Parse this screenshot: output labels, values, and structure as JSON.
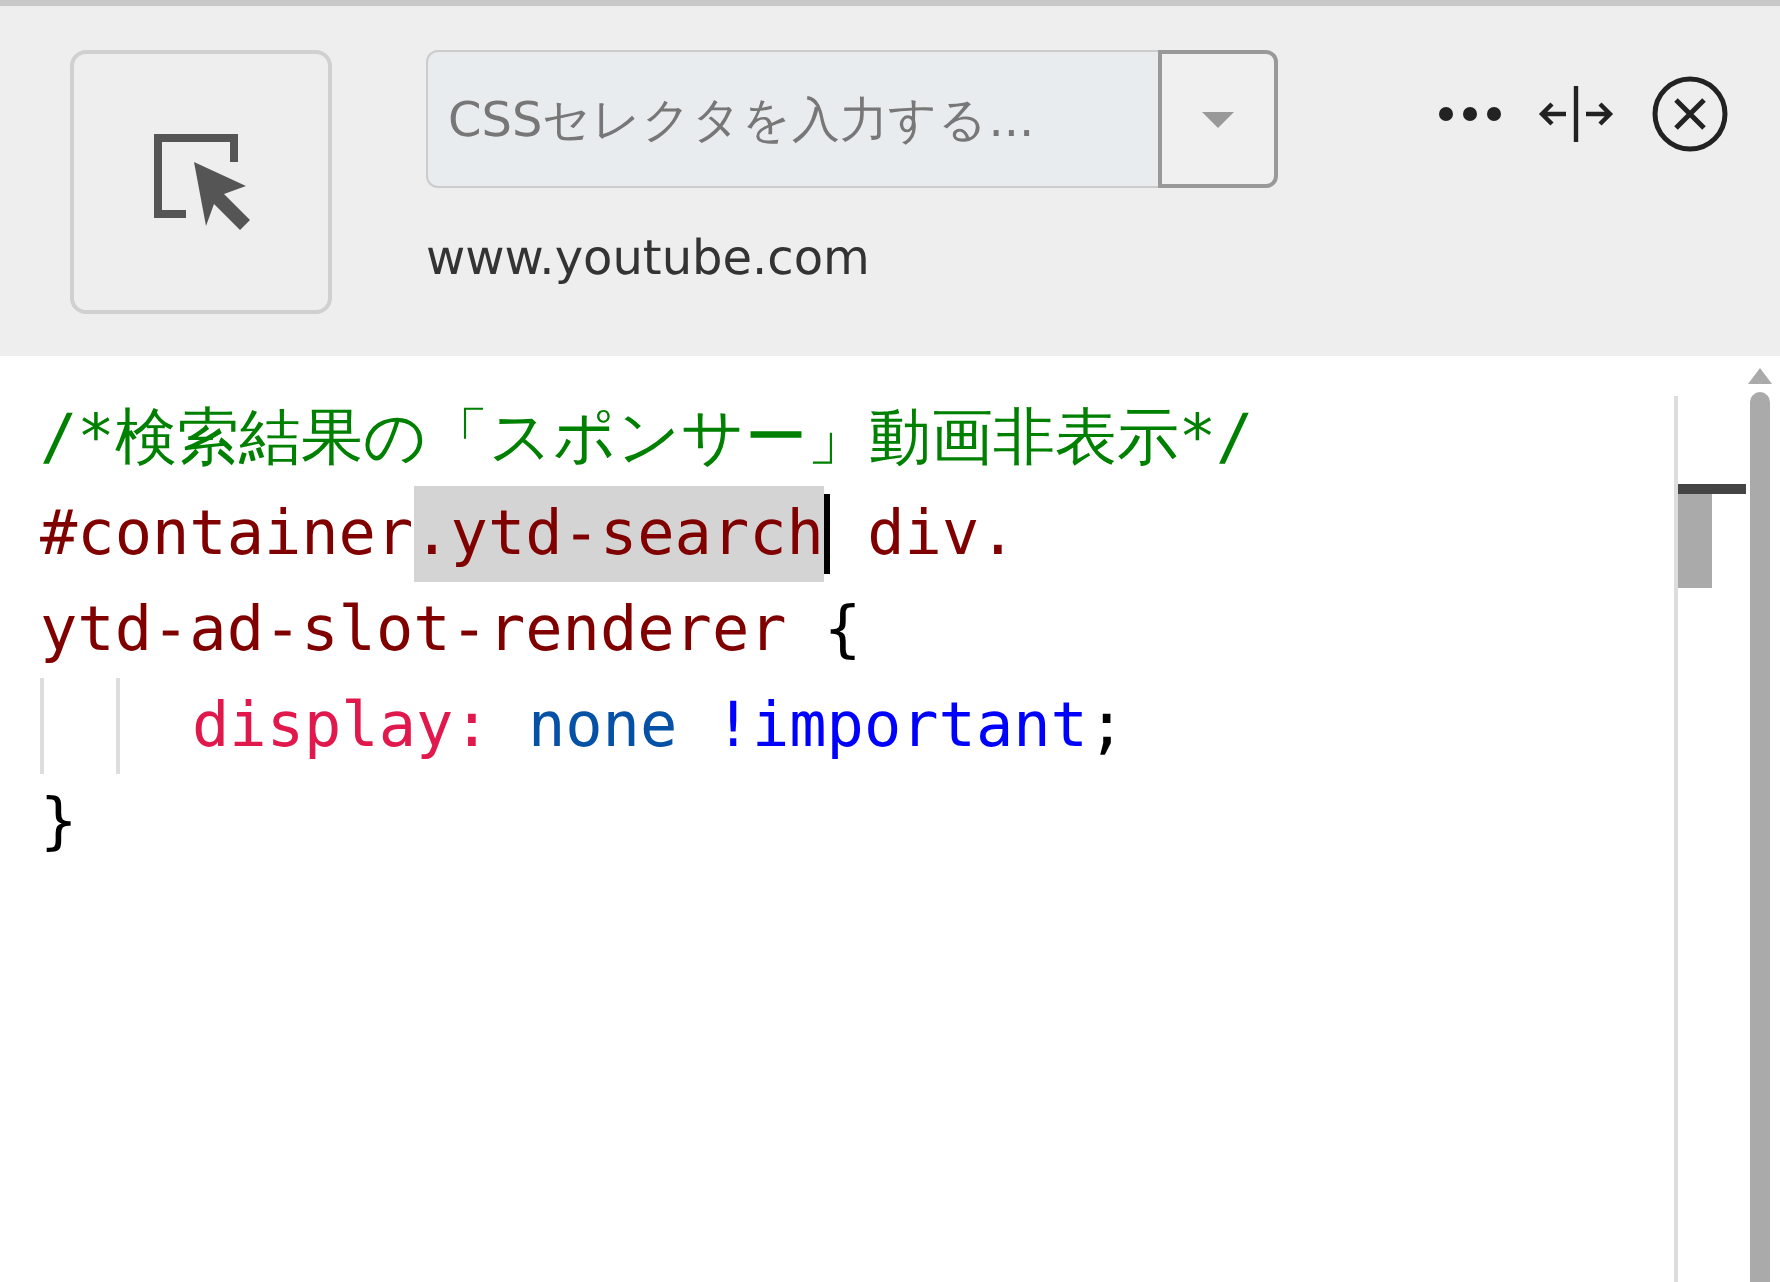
{
  "toolbar": {
    "selector_field": {
      "placeholder": "CSSセレクタを入力する..."
    },
    "hostname": "www.youtube.com"
  },
  "editor": {
    "lines": [
      {
        "indented": false,
        "tokens": [
          {
            "text": "/*検索結果の「スポンサー」動画非表示*/",
            "kind": "comment",
            "selected": false
          }
        ]
      },
      {
        "indented": false,
        "tokens": [
          {
            "text": "#container",
            "kind": "selector",
            "selected": false
          },
          {
            "text": ".ytd-search",
            "kind": "selector",
            "selected": true
          },
          {
            "text": " div.",
            "kind": "selector",
            "selected": false
          }
        ]
      },
      {
        "indented": false,
        "tokens": [
          {
            "text": "ytd-ad-slot-renderer",
            "kind": "selector",
            "selected": false
          },
          {
            "text": " {",
            "kind": "punct",
            "selected": false
          }
        ]
      },
      {
        "indented": true,
        "tokens": [
          {
            "text": "display:",
            "kind": "property",
            "selected": false
          },
          {
            "text": " none",
            "kind": "value",
            "selected": false
          },
          {
            "text": " !important",
            "kind": "important",
            "selected": false
          },
          {
            "text": ";",
            "kind": "punct",
            "selected": false
          }
        ]
      },
      {
        "indented": false,
        "tokens": [
          {
            "text": "}",
            "kind": "punct",
            "selected": false
          }
        ]
      }
    ]
  }
}
